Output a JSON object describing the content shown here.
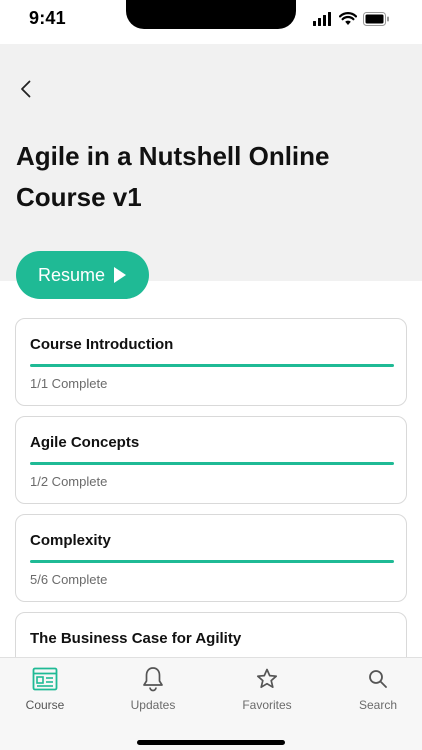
{
  "status_bar": {
    "time": "9:41"
  },
  "header": {
    "back_icon": "chevron-left-icon",
    "title": "Agile in a Nutshell Online Course v1"
  },
  "resume": {
    "label": "Resume",
    "icon": "play-icon",
    "color": "#1fba95"
  },
  "modules": [
    {
      "name": "Course Introduction",
      "status": "1/1 Complete",
      "progress": 1.0
    },
    {
      "name": "Agile Concepts",
      "status": "1/2 Complete",
      "progress": 1.0
    },
    {
      "name": "Complexity",
      "status": "5/6 Complete",
      "progress": 1.0
    },
    {
      "name": "The Business Case for Agility",
      "status": "",
      "progress": 0
    }
  ],
  "tabs": [
    {
      "label": "Course",
      "icon": "course-icon",
      "active": true
    },
    {
      "label": "Updates",
      "icon": "bell-icon",
      "active": false
    },
    {
      "label": "Favorites",
      "icon": "star-icon",
      "active": false
    },
    {
      "label": "Search",
      "icon": "search-icon",
      "active": false
    }
  ],
  "accent_color": "#1fba95"
}
